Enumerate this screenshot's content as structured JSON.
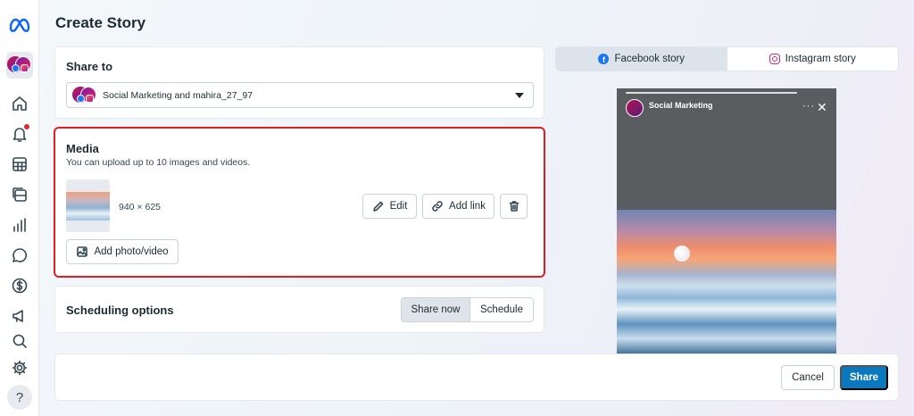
{
  "page": {
    "title": "Create Story"
  },
  "sidebar": {
    "items": [
      {
        "name": "home"
      },
      {
        "name": "notifications"
      },
      {
        "name": "planner"
      },
      {
        "name": "content"
      },
      {
        "name": "insights"
      },
      {
        "name": "inbox"
      },
      {
        "name": "monetization"
      },
      {
        "name": "ads"
      },
      {
        "name": "search"
      },
      {
        "name": "settings"
      }
    ],
    "help_label": "?"
  },
  "share_to": {
    "title": "Share to",
    "selected_account": "Social Marketing and mahira_27_97"
  },
  "media": {
    "title": "Media",
    "subtitle": "You can upload up to 10 images and videos.",
    "item": {
      "dimensions": "940 × 625"
    },
    "edit_label": "Edit",
    "add_link_label": "Add link",
    "add_photo_label": "Add photo/video"
  },
  "scheduling": {
    "title": "Scheduling options",
    "options": [
      "Share now",
      "Schedule"
    ],
    "selected": "Share now"
  },
  "preview": {
    "tabs": [
      {
        "label": "Facebook story",
        "active": true
      },
      {
        "label": "Instagram story",
        "active": false
      }
    ],
    "story": {
      "account_name": "Social Marketing",
      "more_label": "···",
      "close_label": "✕"
    }
  },
  "footer": {
    "cancel_label": "Cancel",
    "share_label": "Share"
  },
  "colors": {
    "accent": "#0a78be",
    "highlight_border": "#e11d24",
    "facebook_blue": "#1877f2"
  }
}
